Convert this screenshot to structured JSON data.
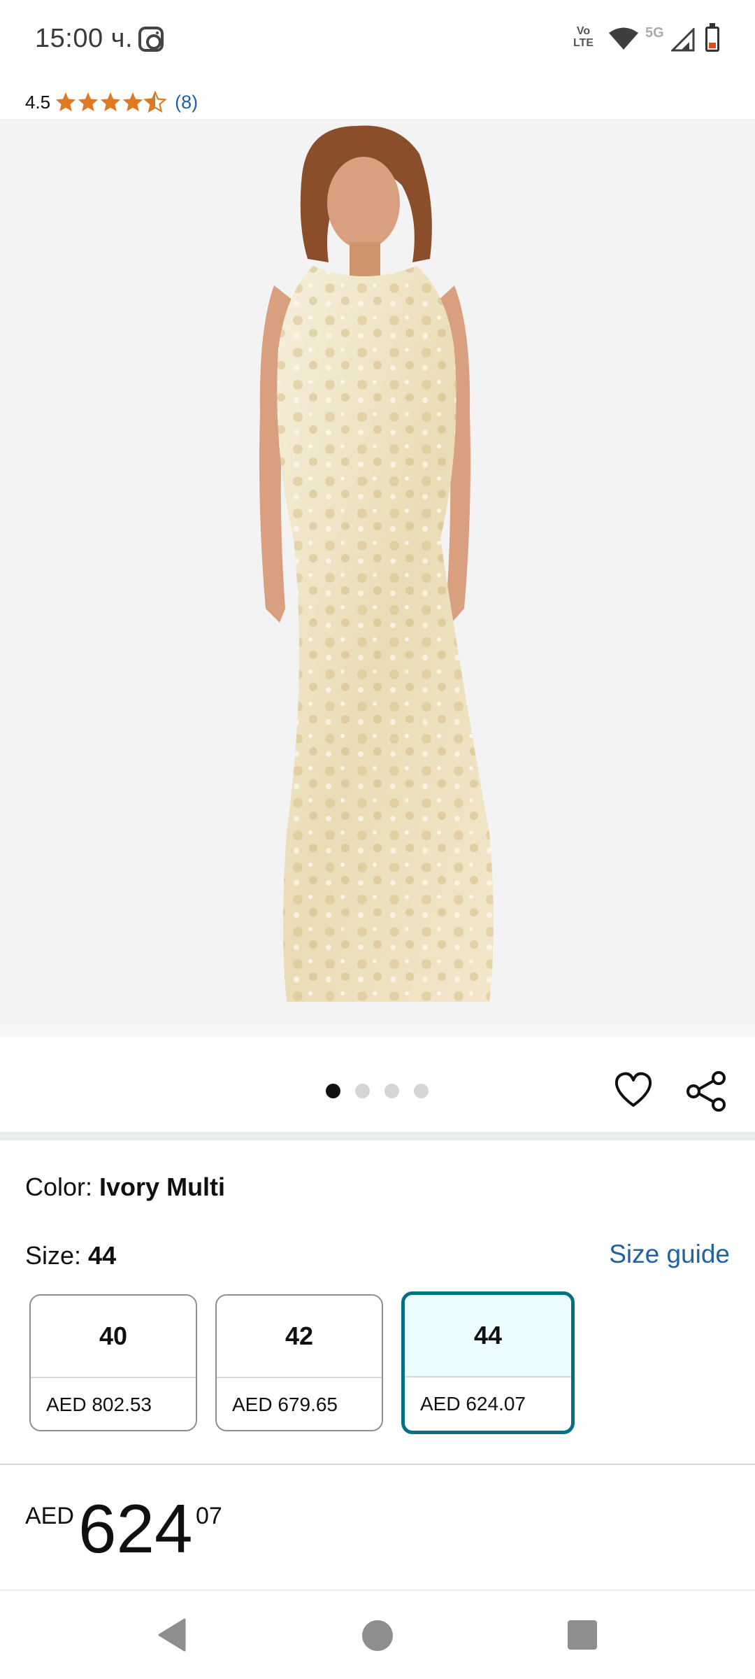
{
  "status_bar": {
    "time": "15:00 ч.",
    "volte_top": "Vo",
    "volte_bottom": "LTE",
    "network": "5G",
    "notification_icon": "instagram-icon",
    "icons": [
      "volte-icon",
      "wifi-icon",
      "signal-icon",
      "battery-icon"
    ]
  },
  "rating": {
    "value": "4.5",
    "stars_filled": 4.5,
    "stars_total": 5,
    "count": "(8)",
    "star_color": "#de7921"
  },
  "product_image": {
    "carousel_total": 4,
    "carousel_active": 1
  },
  "actions": {
    "wishlist_icon": "heart-icon",
    "share_icon": "share-icon"
  },
  "variation": {
    "color_label": "Color: ",
    "color_value": "Ivory Multi",
    "size_label": "Size: ",
    "size_value": "44",
    "size_guide": "Size guide",
    "sizes": [
      {
        "size": "40",
        "price": "AED 802.53",
        "selected": false
      },
      {
        "size": "42",
        "price": "AED 679.65",
        "selected": false
      },
      {
        "size": "44",
        "price": "AED 624.07",
        "selected": true
      }
    ],
    "selected_border_color": "#007185"
  },
  "price": {
    "currency": "AED",
    "whole": "624",
    "fraction": "07"
  },
  "nav": {
    "back_icon": "back-triangle-icon",
    "home_icon": "home-circle-icon",
    "recents_icon": "recents-square-icon"
  },
  "colors": {
    "link": "#2162a1",
    "image_bg": "#f3f3f3"
  }
}
